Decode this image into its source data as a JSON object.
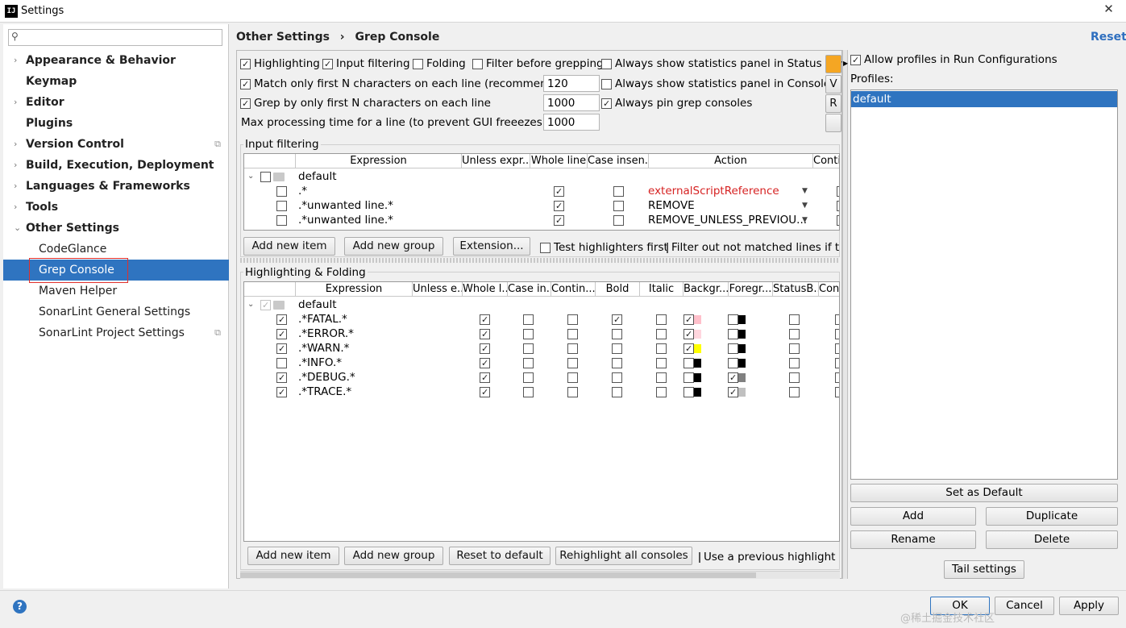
{
  "window": {
    "title": "Settings",
    "app_icon_text": "IJ",
    "close": "✕"
  },
  "sidebar": {
    "search_placeholder": "",
    "items": [
      {
        "label": "Appearance & Behavior",
        "arrow": "›",
        "bold": true
      },
      {
        "label": "Keymap",
        "bold": true
      },
      {
        "label": "Editor",
        "arrow": "›",
        "bold": true
      },
      {
        "label": "Plugins",
        "bold": true
      },
      {
        "label": "Version Control",
        "arrow": "›",
        "bold": true
      },
      {
        "label": "Build, Execution, Deployment",
        "arrow": "›",
        "bold": true
      },
      {
        "label": "Languages & Frameworks",
        "arrow": "›",
        "bold": true
      },
      {
        "label": "Tools",
        "arrow": "›",
        "bold": true
      },
      {
        "label": "Other Settings",
        "arrow": "⌄",
        "bold": true
      },
      {
        "label": "CodeGlance"
      },
      {
        "label": "Grep Console",
        "selected": true
      },
      {
        "label": "Maven Helper"
      },
      {
        "label": "SonarLint General Settings"
      },
      {
        "label": "SonarLint Project Settings"
      }
    ]
  },
  "header": {
    "breadcrumb_parent": "Other Settings",
    "separator": "›",
    "breadcrumb_current": "Grep Console",
    "reset": "Reset"
  },
  "options": {
    "highlighting": "Highlighting",
    "input_filtering": "Input filtering",
    "folding": "Folding",
    "filter_before": "Filter before grepping",
    "stats_status_bar": "Always show statistics panel in Status Bar",
    "match_first_n": "Match only first N characters on each line (recommended)",
    "match_first_n_value": "120",
    "stats_console": "Always show statistics panel in Console",
    "grep_first_n": "Grep by only first N characters on each line",
    "grep_first_n_value": "1000",
    "pin_grep": "Always pin grep consoles",
    "max_time": "Max processing time for a line (to prevent GUI freeezes) [ms]",
    "max_time_value": "1000",
    "side_btn_1": "V",
    "side_btn_2": "R"
  },
  "input_filtering": {
    "title": "Input filtering",
    "columns": [
      "Expression",
      "Unless expr...",
      "Whole line",
      "Case insen...",
      "Action",
      "Conti"
    ],
    "group": "default",
    "rows": [
      {
        "expr": ".*",
        "action": "externalScriptReference"
      },
      {
        "expr": ".*unwanted line.*",
        "action": "REMOVE"
      },
      {
        "expr": ".*unwanted line.*",
        "action": "REMOVE_UNLESS_PREVIOU..."
      }
    ],
    "buttons": {
      "add_item": "Add new item",
      "add_group": "Add new group",
      "extension": "Extension...",
      "test_first": "Test highlighters first",
      "filter_out": "Filter out not matched lines if th"
    }
  },
  "highlighting": {
    "title": "Highlighting & Folding",
    "columns": [
      "Expression",
      "Unless e...",
      "Whole l...",
      "Case in...",
      "Contin...",
      "Bold",
      "Italic",
      "Backgr...",
      "Foregr...",
      "StatusB...",
      "Cons"
    ],
    "group": "default",
    "rows": [
      {
        "expr": ".*FATAL.*"
      },
      {
        "expr": ".*ERROR.*"
      },
      {
        "expr": ".*WARN.*"
      },
      {
        "expr": ".*INFO.*"
      },
      {
        "expr": ".*DEBUG.*"
      },
      {
        "expr": ".*TRACE.*"
      }
    ],
    "colors": {
      "pink": "#ffc0cb",
      "yellow": "#ffff00",
      "black": "#000000",
      "gray": "#808080",
      "lightgray": "#c0c0c0"
    },
    "buttons": {
      "add_item": "Add new item",
      "add_group": "Add new group",
      "reset": "Reset to default",
      "rehighlight": "Rehighlight all consoles",
      "use_previous": "Use a previous highlight if"
    }
  },
  "profiles": {
    "allow": "Allow profiles in Run Configurations",
    "label": "Profiles:",
    "selected": "default",
    "set_default": "Set as Default",
    "add": "Add",
    "duplicate": "Duplicate",
    "rename": "Rename",
    "delete": "Delete",
    "tail": "Tail settings"
  },
  "footer": {
    "ok": "OK",
    "cancel": "Cancel",
    "apply": "Apply",
    "help": "?",
    "watermark": "@稀土掘金技术社区"
  }
}
